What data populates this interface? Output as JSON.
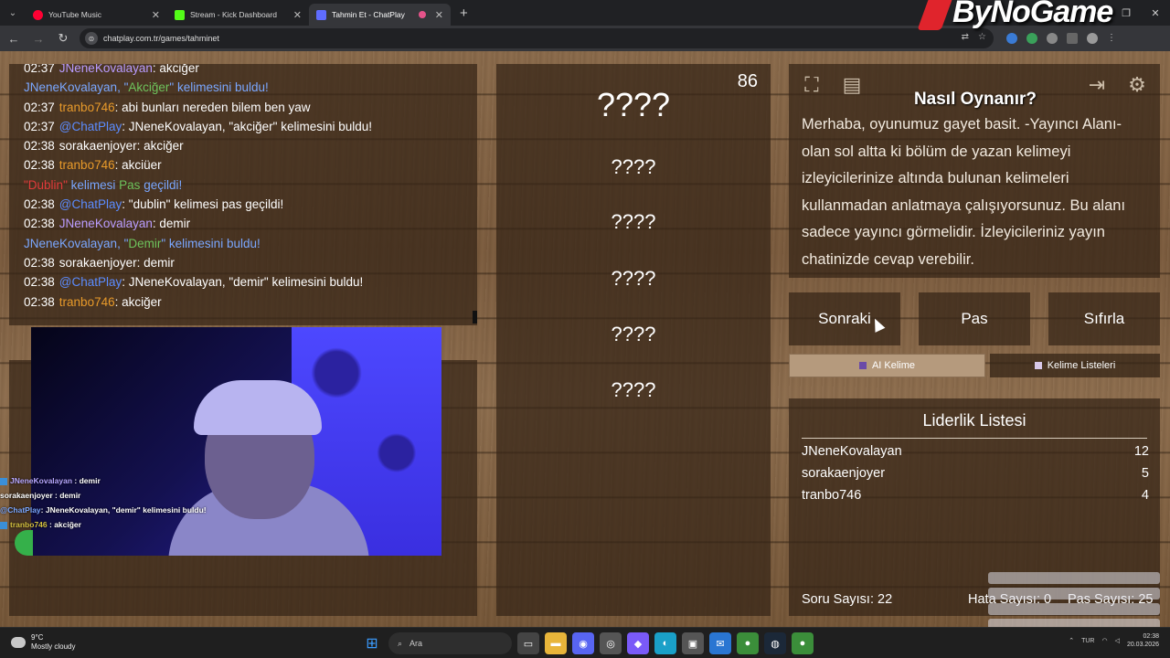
{
  "browser": {
    "tabs": [
      {
        "label": "YouTube Music",
        "color": "#ff0033",
        "active": false
      },
      {
        "label": "Stream - Kick Dashboard",
        "color": "#53fc18",
        "active": false
      },
      {
        "label": "Tahmin Et - ChatPlay",
        "color": "#5f6cff",
        "active": true
      }
    ],
    "url": "chatplay.com.tr/games/tahminet"
  },
  "chat": {
    "lines": [
      {
        "time": "02:37",
        "user": "JNeneKovalayan",
        "user_color": "#b99cff",
        "text": "akciğer"
      },
      {
        "type": "found",
        "user": "JNeneKovalayan",
        "word": "Akciğer"
      },
      {
        "time": "02:37",
        "user": "tranbo746",
        "user_color": "#e89a2a",
        "text": "abi bunları nereden bilem ben yaw"
      },
      {
        "time": "02:37",
        "user": "@ChatPlay",
        "user_color": "#5b8cff",
        "text": "JNeneKovalayan, \"akciğer\" kelimesini buldu!"
      },
      {
        "time": "02:38",
        "user": "sorakaenjoyer",
        "user_color": "#ffffff",
        "text": "akciğer"
      },
      {
        "time": "02:38",
        "user": "tranbo746",
        "user_color": "#e89a2a",
        "text": "akciüer"
      },
      {
        "type": "pass",
        "word": "Dublin"
      },
      {
        "time": "02:38",
        "user": "@ChatPlay",
        "user_color": "#5b8cff",
        "text": "\"dublin\" kelimesi pas geçildi!"
      },
      {
        "time": "02:38",
        "user": "JNeneKovalayan",
        "user_color": "#b99cff",
        "text": "demir"
      },
      {
        "type": "found",
        "user": "JNeneKovalayan",
        "word": "Demir"
      },
      {
        "time": "02:38",
        "user": "sorakaenjoyer",
        "user_color": "#ffffff",
        "text": "demir"
      },
      {
        "time": "02:38",
        "user": "@ChatPlay",
        "user_color": "#5b8cff",
        "text": "JNeneKovalayan, \"demir\" kelimesini buldu!"
      },
      {
        "time": "02:38",
        "user": "tranbo746",
        "user_color": "#e89a2a",
        "text": "akciğer"
      }
    ],
    "found_suffix": "kelimesini buldu!",
    "pass_middle": "kelimesi",
    "pass_word": "Pas",
    "pass_end": "geçildi!"
  },
  "overlay_chat": [
    {
      "user": "JNeneKovalayan",
      "text": ": demir"
    },
    {
      "user": "sorakaenjoyer",
      "text": ": demir"
    },
    {
      "user": "@ChatPlay",
      "text": ": JNeneKovalayan, \"demir\" kelimesini buldu!"
    },
    {
      "user": "tranbo746",
      "text": ": akciğer"
    }
  ],
  "game": {
    "counter": "86",
    "words": [
      "????",
      "????",
      "????",
      "????",
      "????",
      "????"
    ],
    "how_to_play": "Nasıl Oynanır?",
    "brand": "ByNoGame",
    "description": "Merhaba, oyunumuz gayet basit. -Yayıncı Alanı- olan sol altta ki bölüm de yazan kelimeyi izleyicilerinize altında bulunan kelimeleri kullanmadan anlatmaya çalışıyorsunuz. Bu alanı sadece yayıncı görmelidir. İzleyicileriniz yayın chatinizde cevap verebilir.",
    "buttons": {
      "next": "Sonraki",
      "pass": "Pas",
      "reset": "Sıfırla"
    },
    "modes": {
      "ai": "AI Kelime",
      "lists": "Kelime Listeleri"
    },
    "leaderboard": {
      "title": "Liderlik Listesi",
      "rows": [
        {
          "name": "JNeneKovalayan",
          "score": "12"
        },
        {
          "name": "sorakaenjoyer",
          "score": "5"
        },
        {
          "name": "tranbo746",
          "score": "4"
        }
      ]
    },
    "stats": {
      "questions": "Soru Sayısı: 22",
      "errors": "Hata Sayısı: 0",
      "passes": "Pas Sayısı: 25"
    }
  },
  "taskbar": {
    "weather_temp": "9°C",
    "weather_desc": "Mostly cloudy",
    "search": "Ara",
    "lang": "TUR",
    "time": "02:38",
    "date": "20.03.2026"
  }
}
